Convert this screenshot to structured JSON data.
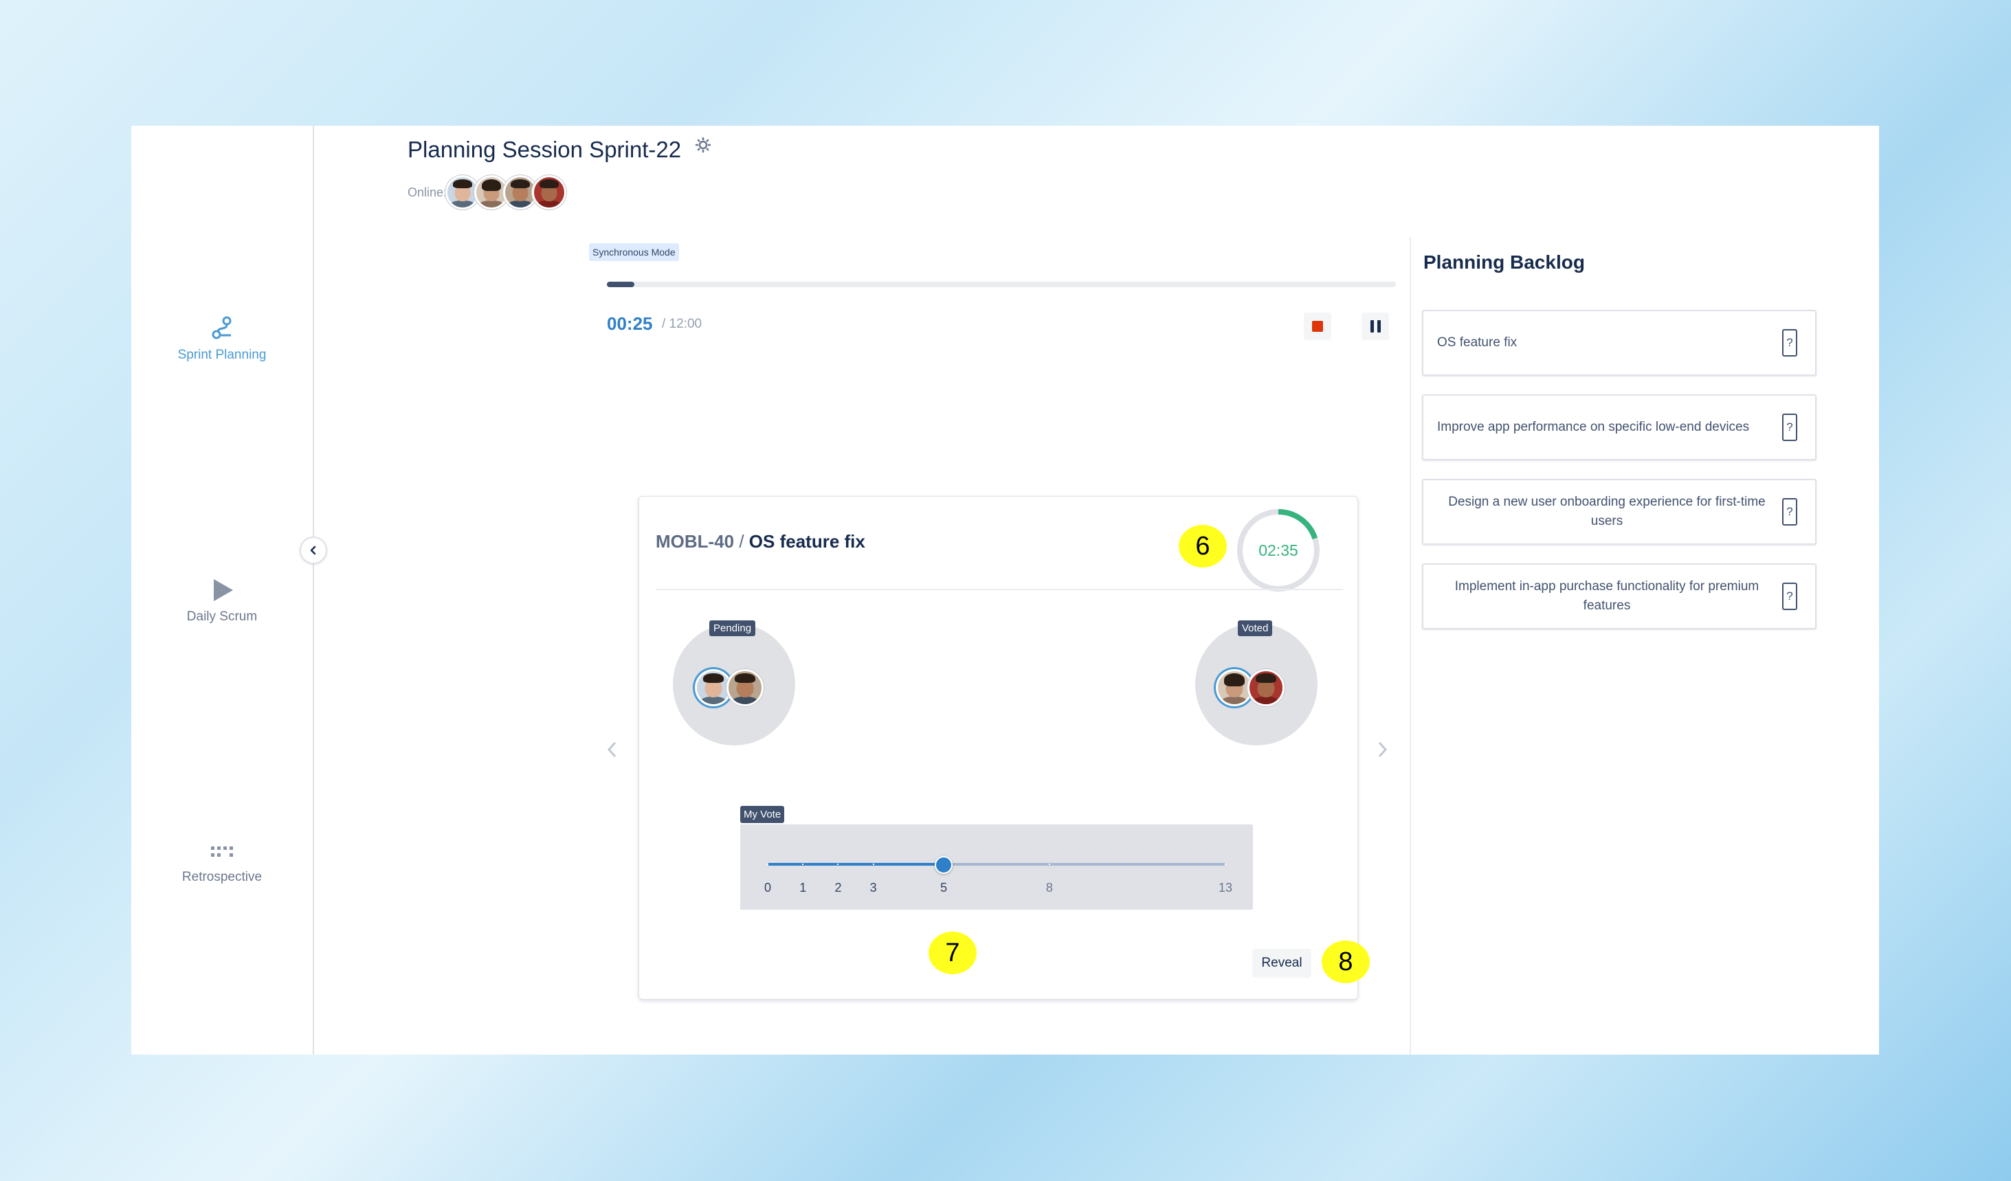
{
  "sidebar": {
    "items": [
      {
        "label": "Sprint Planning",
        "icon": "sprint-planning-icon",
        "active": true
      },
      {
        "label": "Daily Scrum",
        "icon": "play-icon",
        "active": false
      },
      {
        "label": "Retrospective",
        "icon": "grid-dots-icon",
        "active": false
      }
    ]
  },
  "header": {
    "title": "Planning Session Sprint-22",
    "online_label": "Online:",
    "online_count": 4
  },
  "session": {
    "mode": "Synchronous Mode",
    "progress_fraction": 0.035,
    "elapsed": "00:25",
    "total": "/ 12:00"
  },
  "card": {
    "issue_key": "MOBL-40",
    "separator": " / ",
    "summary": "OS feature fix",
    "countdown": "02:35",
    "countdown_fraction": 0.2,
    "pending_label": "Pending",
    "voted_label": "Voted",
    "my_vote_label": "My Vote",
    "vote_scale": [
      "0",
      "1",
      "2",
      "3",
      "5",
      "8",
      "13"
    ],
    "selected_vote": "5",
    "reveal_label": "Reveal"
  },
  "markers": {
    "m6": "6",
    "m7": "7",
    "m8": "8"
  },
  "backlog": {
    "title": "Planning Backlog",
    "items": [
      {
        "text": "OS feature fix",
        "estimate": "?"
      },
      {
        "text": "Improve app performance on specific low-end devices",
        "estimate": "?"
      },
      {
        "text": "Design a new user onboarding experience for first-time users",
        "estimate": "?"
      },
      {
        "text": "Implement in-app purchase functionality for premium features",
        "estimate": "?"
      }
    ]
  },
  "colors": {
    "accent": "#2f80c9",
    "stop": "#de350b",
    "countdown": "#36b37e",
    "marker": "#ffff1f"
  }
}
